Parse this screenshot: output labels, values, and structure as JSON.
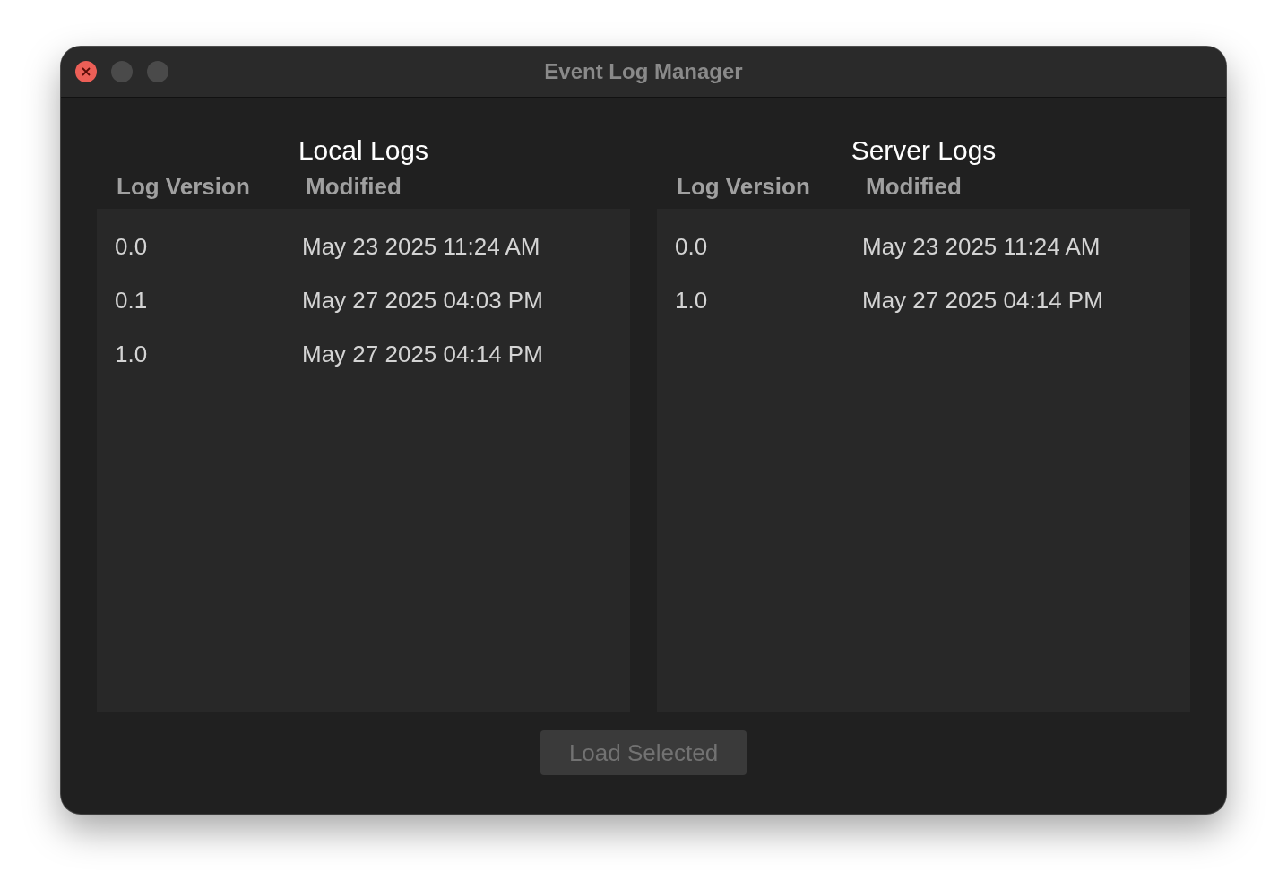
{
  "window": {
    "title": "Event Log Manager"
  },
  "panels": [
    {
      "title": "Local Logs",
      "columns": [
        "Log Version",
        "Modified"
      ],
      "rows": [
        {
          "version": "0.0",
          "modified": "May 23 2025 11:24 AM"
        },
        {
          "version": "0.1",
          "modified": "May 27 2025 04:03 PM"
        },
        {
          "version": "1.0",
          "modified": "May 27 2025 04:14 PM"
        }
      ]
    },
    {
      "title": "Server Logs",
      "columns": [
        "Log Version",
        "Modified"
      ],
      "rows": [
        {
          "version": "0.0",
          "modified": "May 23 2025 11:24 AM"
        },
        {
          "version": "1.0",
          "modified": "May 27 2025 04:14 PM"
        }
      ]
    }
  ],
  "load_button": {
    "label": "Load Selected",
    "disabled": true
  }
}
